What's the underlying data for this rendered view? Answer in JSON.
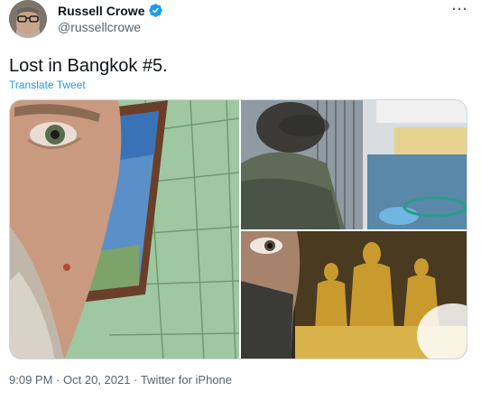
{
  "author": {
    "name": "Russell Crowe",
    "handle": "@russellcrowe",
    "verified_icon": "verified-badge-icon",
    "verified_color": "#1d9bf0"
  },
  "more_label": "···",
  "tweet": {
    "text": "Lost in Bangkok #5.",
    "translate_label": "Translate Tweet"
  },
  "media": {
    "photos": [
      "photo-1",
      "photo-2",
      "photo-3"
    ]
  },
  "meta": {
    "time": "9:09 PM",
    "sep1": "·",
    "date": "Oct 20, 2021",
    "sep2": "·",
    "source": "Twitter for iPhone"
  },
  "colors": {
    "link": "#1d9bf0",
    "secondary_text": "#536471",
    "primary_text": "#0f1419"
  }
}
